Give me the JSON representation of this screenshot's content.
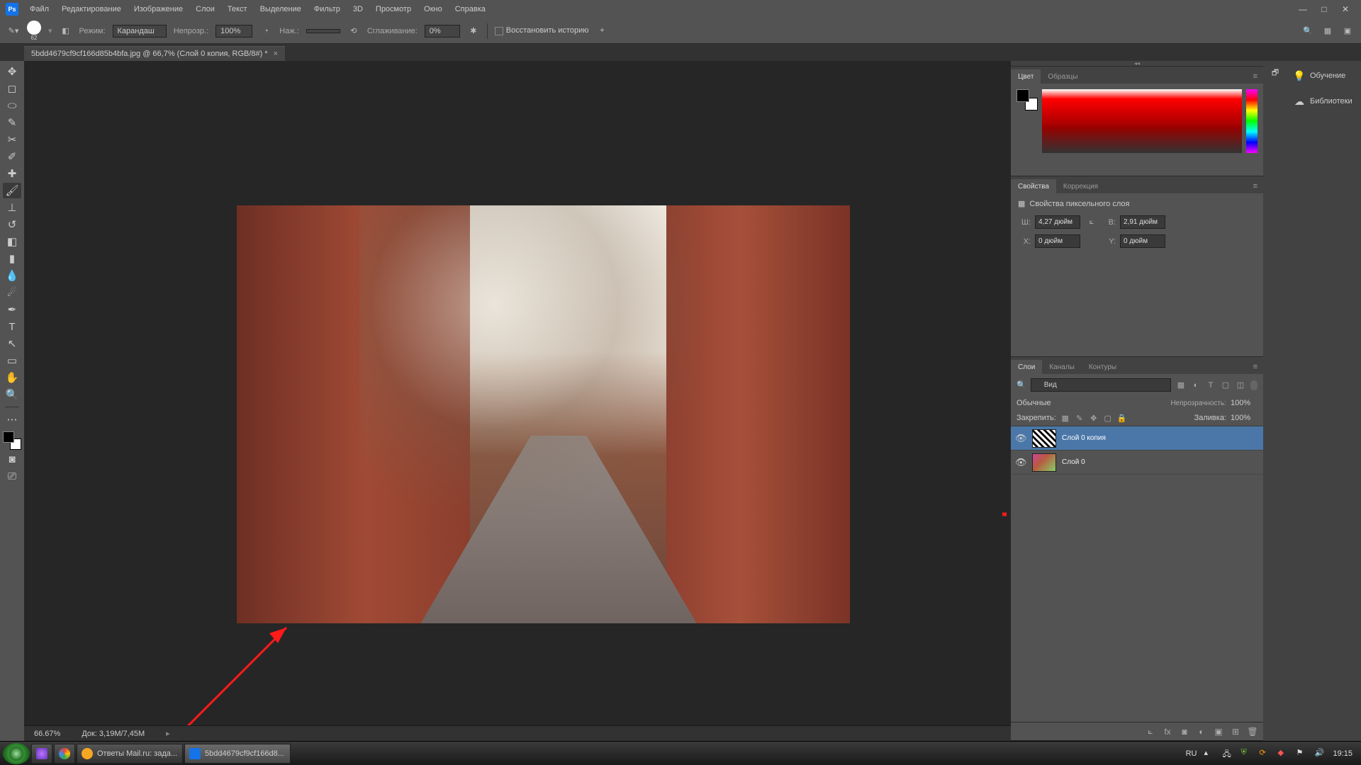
{
  "menu": {
    "items": [
      "Файл",
      "Редактирование",
      "Изображение",
      "Слои",
      "Текст",
      "Выделение",
      "Фильтр",
      "3D",
      "Просмотр",
      "Окно",
      "Справка"
    ]
  },
  "window": {
    "min": "—",
    "max": "□",
    "close": "✕"
  },
  "options": {
    "brush_size": "62",
    "mode_label": "Режим:",
    "mode_value": "Карандаш",
    "opacity_label": "Непрозр.:",
    "opacity_value": "100%",
    "flow_label": "Наж.:",
    "smoothing_label": "Сглаживание:",
    "smoothing_value": "0%",
    "restore_label": "Восстановить историю"
  },
  "document": {
    "tab_title": "5bdd4679cf9cf166d85b4bfa.jpg @ 66,7% (Слой 0 копия, RGB/8#) *",
    "zoom": "66.67%",
    "docinfo": "Док: 3,19M/7,45M"
  },
  "panels": {
    "color": {
      "tabs": [
        "Цвет",
        "Образцы"
      ]
    },
    "properties": {
      "tabs": [
        "Свойства",
        "Коррекция"
      ],
      "heading": "Свойства пиксельного слоя",
      "w_label": "Ш:",
      "w_value": "4,27 дюйм",
      "h_label": "В:",
      "h_value": "2,91 дюйм",
      "x_label": "X:",
      "x_value": "0 дюйм",
      "y_label": "Y:",
      "y_value": "0 дюйм"
    },
    "layers": {
      "tabs": [
        "Слои",
        "Каналы",
        "Контуры"
      ],
      "search": "Вид",
      "blend_value": "Обычные",
      "opacity_label": "Непрозрачность:",
      "opacity_value": "100%",
      "lock_label": "Закрепить:",
      "fill_label": "Заливка:",
      "fill_value": "100%",
      "items": [
        {
          "name": "Слой 0 копия",
          "active": true,
          "bw": true
        },
        {
          "name": "Слой 0",
          "active": false,
          "bw": false
        }
      ]
    },
    "side": {
      "learn": "Обучение",
      "libs": "Библиотеки"
    }
  },
  "taskbar": {
    "items": [
      {
        "label": "Ответы Mail.ru: зада...",
        "color": "#f5a623"
      },
      {
        "label": "5bdd4679cf9cf166d8...",
        "color": "#1473e6"
      }
    ],
    "lang": "RU",
    "time": "19:15"
  }
}
